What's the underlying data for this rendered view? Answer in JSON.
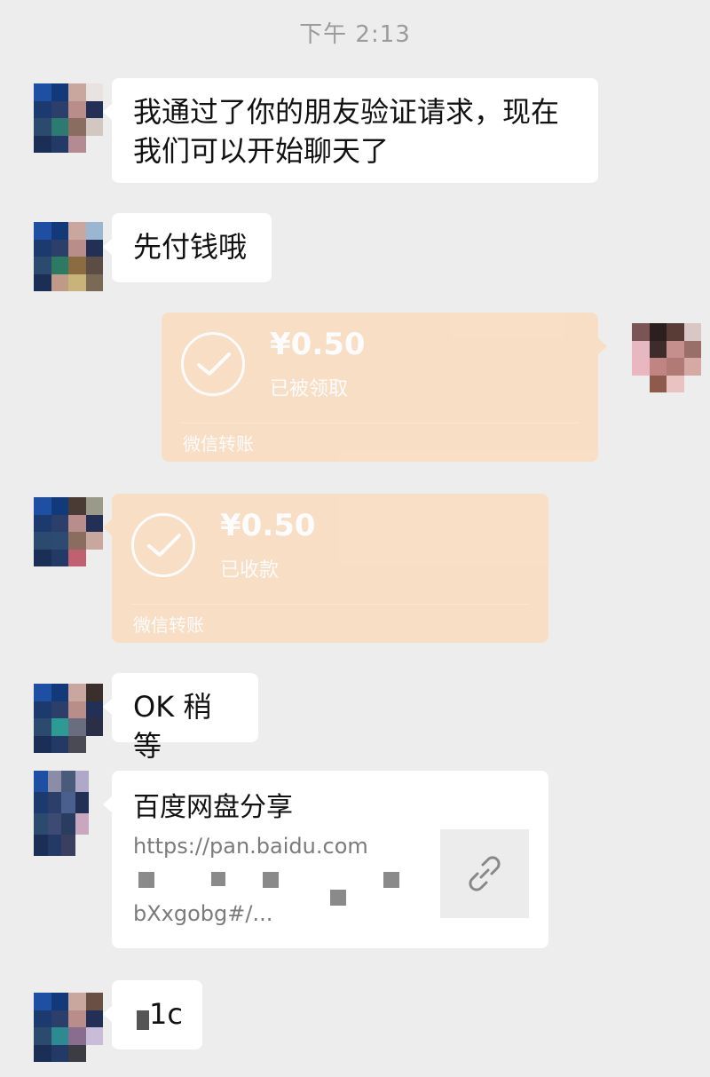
{
  "timestamp": "下午 2:13",
  "messages": {
    "m1_text": "我通过了你的朋友验证请求，现在我们可以开始聊天了",
    "m2_text": "先付钱哦",
    "m3": {
      "amount": "¥0.50",
      "status": "已被领取",
      "footer": "微信转账"
    },
    "m4": {
      "amount": "¥0.50",
      "status": "已收款",
      "footer": "微信转账"
    },
    "m5_text": "OK 稍等",
    "m6": {
      "title": "百度网盘分享",
      "url_line1": "https://pan.baidu.com",
      "url_line3": "bXxgobg#/...",
      "icon": "link-icon"
    },
    "m7_text": "1c"
  },
  "colors": {
    "background": "#ededed",
    "bubble": "#ffffff",
    "transfer": "#f9dcbd",
    "timestamp": "#9b9b9b"
  }
}
